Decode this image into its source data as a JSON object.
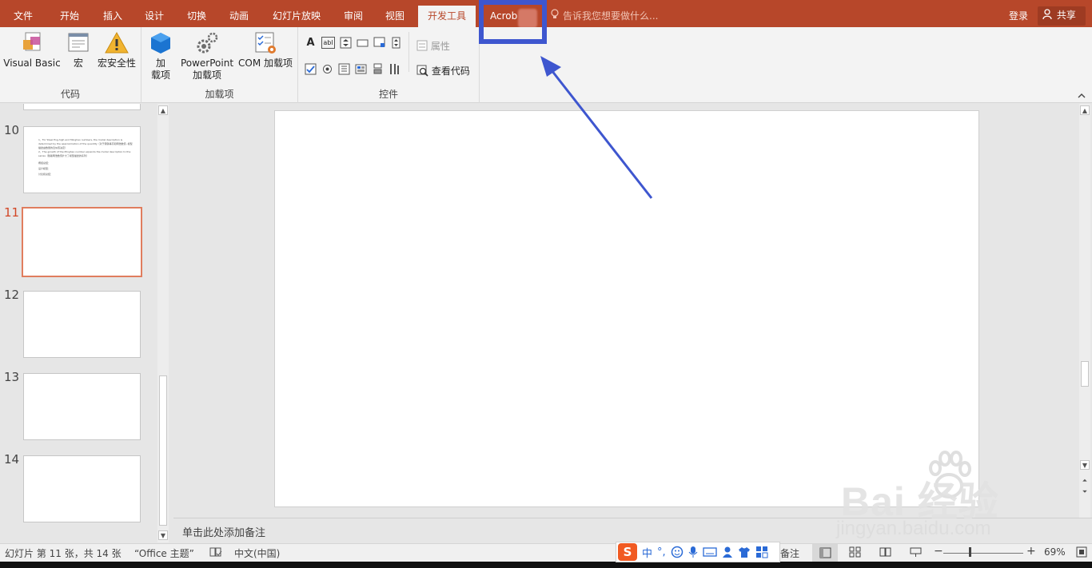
{
  "tabs": [
    "文件",
    "开始",
    "插入",
    "设计",
    "切换",
    "动画",
    "幻灯片放映",
    "审阅",
    "视图",
    "开发工具",
    "Acrob"
  ],
  "active_tab": "开发工具",
  "tell_me": "告诉我您想要做什么...",
  "login": "登录",
  "share": "共享",
  "ribbon": {
    "code_group": {
      "label": "代码",
      "visual_basic": "Visual Basic",
      "macro": "宏",
      "macro_security": "宏安全性"
    },
    "addins_group": {
      "label": "加载项",
      "addins_line1": "加",
      "addins_line2": "载项",
      "ppt_addins_line1": "PowerPoint",
      "ppt_addins_line2": "加载项",
      "com_addins": "COM 加载项"
    },
    "controls_group": {
      "label": "控件",
      "properties": "属性",
      "view_code": "查看代码",
      "label_icon_text": "A",
      "textbox_icon_text": "abl"
    }
  },
  "thumbnails": {
    "items": [
      {
        "number": "10",
        "lines": [
          "1、For Steel Eng-high and Minghao numbers, the model description is determined by the approximation of the quantity（对于钢铁等高和明浩数值, 模型描述由数量的近似值决定）",
          "2、The growth of the Minghao number expands the model description to the series（随着明浩数值扩大了模型描述的系列）"
        ],
        "sublines": [
          "概括总结：",
          "设计模型：",
          "讨论和总结："
        ]
      },
      {
        "number": "11"
      },
      {
        "number": "12"
      },
      {
        "number": "13"
      },
      {
        "number": "14"
      }
    ],
    "selected": "11"
  },
  "notes_placeholder": "单击此处添加备注",
  "status": {
    "slide_info": "幻灯片 第 11 张，共 14 张",
    "theme": "“Office 主题”",
    "language": "中文(中国)",
    "notes": "备注",
    "zoom": "69%"
  },
  "ime": {
    "logo": "S",
    "lang": "中",
    "punct": "°,"
  },
  "watermark": {
    "line1": "Bai 经验",
    "line2": "jingyan.baidu.com"
  },
  "colors": {
    "brand": "#b7472a",
    "annotation": "#3e56cf",
    "selection": "#e07d5e"
  }
}
